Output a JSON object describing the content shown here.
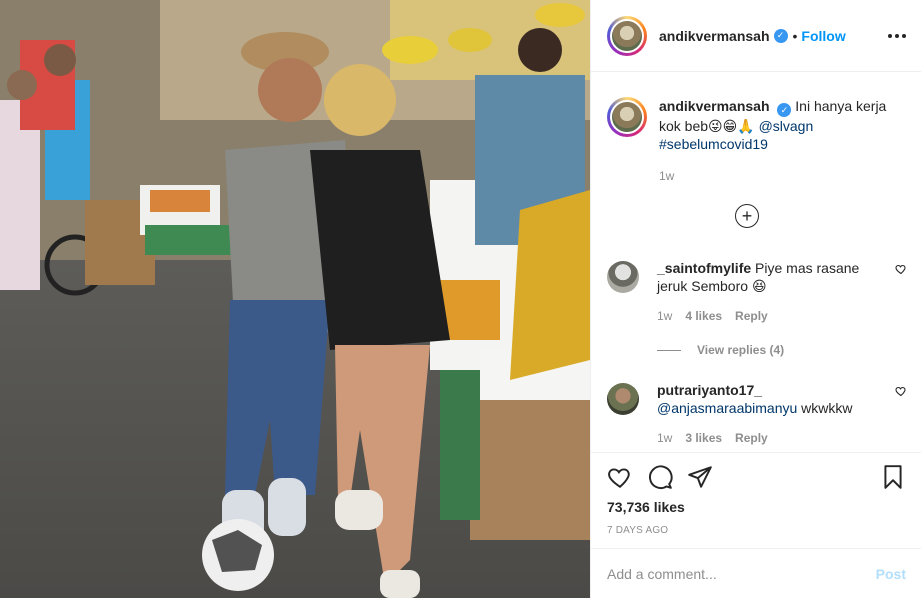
{
  "post": {
    "username": "andikvermansah",
    "follow_label": "Follow",
    "bullet": "•",
    "caption": {
      "username": "andikvermansah",
      "text": "Ini hanya kerja kok beb",
      "emojis": "😜😁🙏",
      "mention": "@slvagn",
      "hashtag": "#sebelumcovid19",
      "time": "1w"
    },
    "load_more_icon": "plus-circle-icon",
    "comments": [
      {
        "username": "_saintofmylife",
        "text": "Piye mas rasane jeruk Semboro",
        "emoji": "😆",
        "time": "1w",
        "likes": "4 likes",
        "reply_label": "Reply",
        "view_replies": "View replies (4)"
      },
      {
        "username": "putrariyanto17_",
        "mention": "@anjasmaraabimanyu",
        "text": "wkwkkw",
        "time": "1w",
        "likes": "3 likes",
        "reply_label": "Reply"
      }
    ],
    "likes_count": "73,736 likes",
    "time_ago": "7 DAYS AGO",
    "comment_placeholder": "Add a comment...",
    "post_label": "Post",
    "colors": {
      "follow_blue": "#0095f6",
      "verified_blue": "#3897f0",
      "post_disabled": "#b2dffc",
      "secondary_text": "#8e8e8e"
    }
  }
}
